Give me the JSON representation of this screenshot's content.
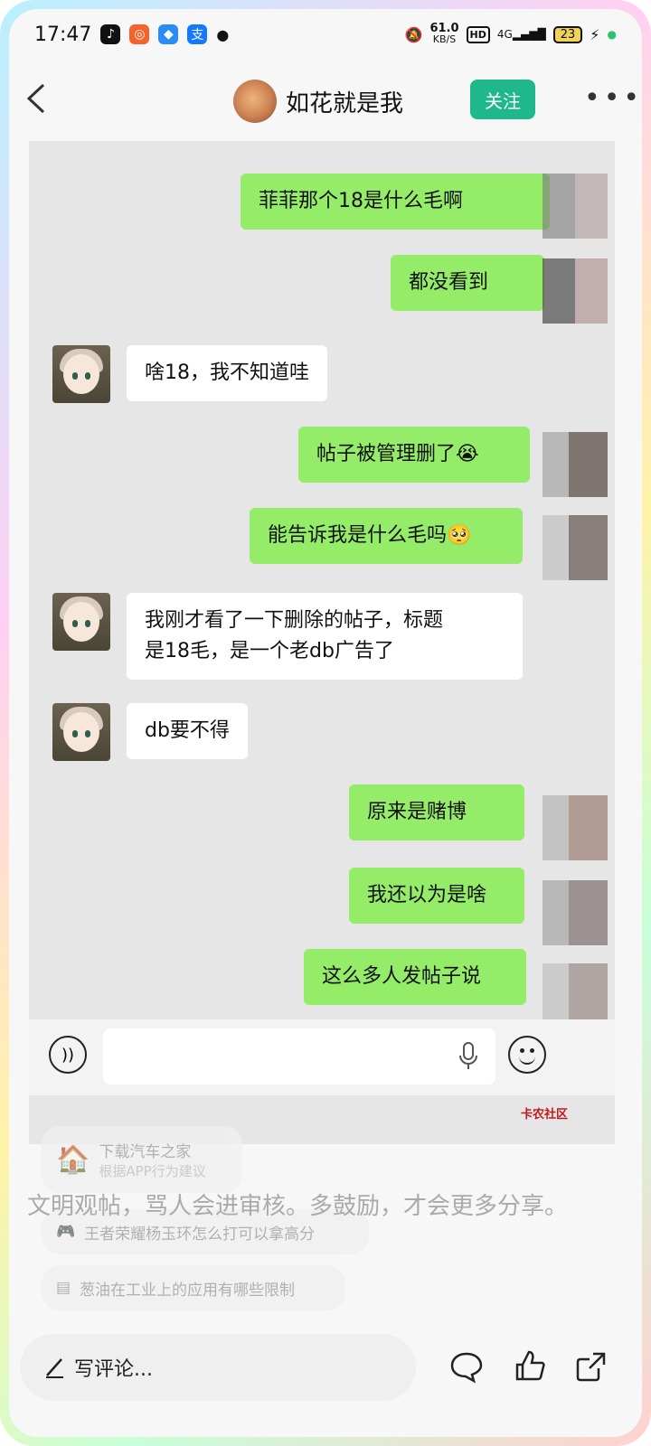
{
  "status": {
    "time": "17:47",
    "net_speed_value": "61.0",
    "net_speed_unit": "KB/S",
    "hd": "HD",
    "signal": "4G",
    "battery": "23"
  },
  "header": {
    "contact_name": "如花就是我",
    "follow_label": "关注"
  },
  "messages": [
    {
      "side": "out",
      "text": "菲菲那个18是什么毛啊"
    },
    {
      "side": "out",
      "text": "都没看到"
    },
    {
      "side": "in",
      "text": "啥18，我不知道哇"
    },
    {
      "side": "out",
      "text": "帖子被管理删了😭"
    },
    {
      "side": "out",
      "text": "能告诉我是什么毛吗🥺"
    },
    {
      "side": "in",
      "text": "我刚才看了一下删除的帖子，标题\n是18毛，是一个老db广告了"
    },
    {
      "side": "in",
      "text": "db要不得"
    },
    {
      "side": "out",
      "text": "原来是赌博"
    },
    {
      "side": "out",
      "text": "我还以为是啥"
    },
    {
      "side": "out",
      "text": "这么多人发帖子说"
    }
  ],
  "watermark": "卡农社区",
  "recommendations": {
    "item1_title": "下载汽车之家",
    "item1_sub": "根据APP行为建议",
    "item2": "王者荣耀杨玉环怎么打可以拿高分",
    "item3": "葱油在工业上的应用有哪些限制"
  },
  "rules_text": "文明观帖，骂人会进审核。多鼓励，才会更多分享。",
  "bottom": {
    "comment_placeholder": "写评论..."
  },
  "icons": [
    "back-icon",
    "voice-icon",
    "mic-icon",
    "emoji-icon",
    "pencil-icon",
    "comment-icon",
    "like-icon",
    "share-icon"
  ]
}
